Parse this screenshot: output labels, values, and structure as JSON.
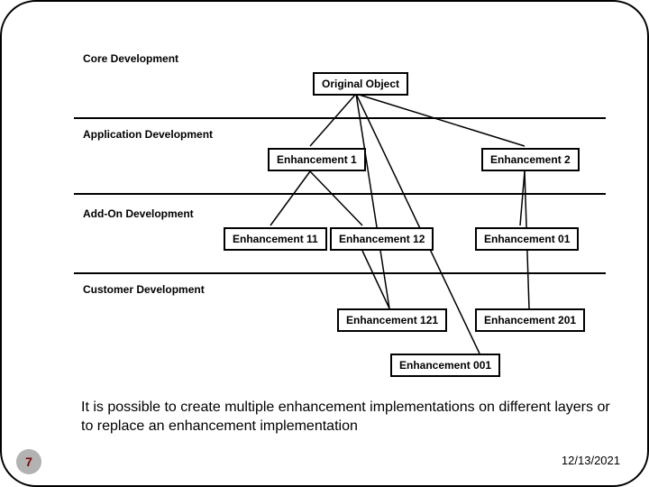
{
  "layers": {
    "core": "Core Development",
    "application": "Application Development",
    "addon": "Add-On Development",
    "customer": "Customer Development"
  },
  "nodes": {
    "original": "Original Object",
    "e1": "Enhancement 1",
    "e2": "Enhancement 2",
    "e11": "Enhancement 11",
    "e12": "Enhancement 12",
    "e01": "Enhancement 01",
    "e121": "Enhancement 121",
    "e201": "Enhancement 201",
    "e001": "Enhancement 001"
  },
  "caption": "It is possible to create multiple enhancement implementations on different layers or to replace an enhancement implementation",
  "page": "7",
  "date": "12/13/2021"
}
